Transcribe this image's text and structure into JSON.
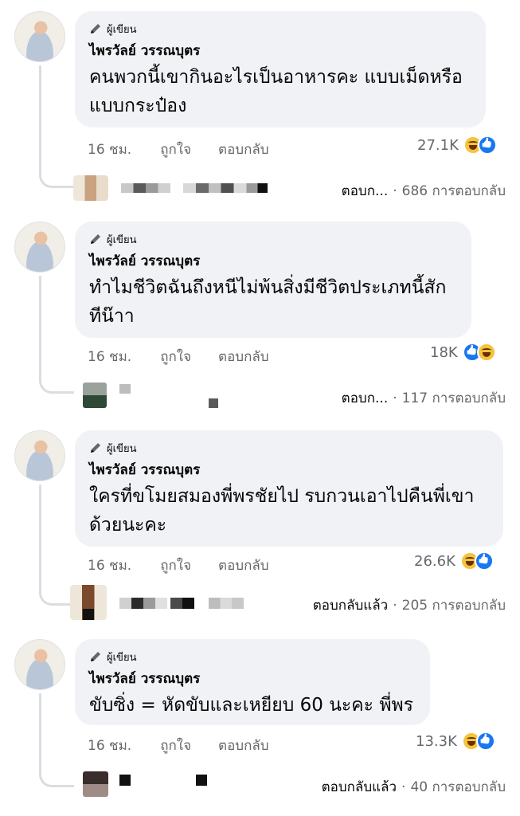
{
  "author_badge": "ผู้เขียน",
  "author_name": "ไพรวัลย์ วรรณบุตร",
  "actions": {
    "like": "ถูกใจ",
    "reply": "ตอบกลับ"
  },
  "comments": [
    {
      "text_line1": "คนพวกนี้เขากินอะไรเป็นอาหารคะ แบบเม็ดหรือ",
      "text_line2": "แบบกระป๋อง",
      "time": "16 ชม.",
      "reaction_count": "27.1K",
      "reactions": [
        "haha-icon",
        "like-icon"
      ],
      "reply_lead": "ตอบก...",
      "reply_count": "686 การตอบกลับ"
    },
    {
      "text_line1": "ทำไมชีวิตฉันถึงหนีไม่พ้นสิ่งมีชีวิตประเภทนี้สัก",
      "text_line2": "ทีน๊าา",
      "time": "16 ชม.",
      "reaction_count": "18K",
      "reactions": [
        "like-icon",
        "haha-icon"
      ],
      "reply_lead": "ตอบก...",
      "reply_count": "117 การตอบกลับ"
    },
    {
      "text_line1": "ใครที่ขโมยสมองพี่พรชัยไป รบกวนเอาไปคืนพี่เขา",
      "text_line2": "ด้วยนะคะ",
      "time": "16 ชม.",
      "reaction_count": "26.6K",
      "reactions": [
        "haha-icon",
        "like-icon"
      ],
      "reply_lead": "ตอบกลับแล้ว",
      "reply_count": "205 การตอบกลับ"
    },
    {
      "text_line1": "ขับซิ่ง = หัดขับและเหยียบ 60 นะคะ พี่พร",
      "text_line2": "",
      "time": "16 ชม.",
      "reaction_count": "13.3K",
      "reactions": [
        "haha-icon",
        "like-icon"
      ],
      "reply_lead": "ตอบกลับแล้ว",
      "reply_count": "40 การตอบกลับ"
    }
  ],
  "colors": {
    "bubble": "#f0f2f5",
    "meta": "#65676b",
    "like_blue": "#1877f2",
    "haha_yellow": "#f7c23c"
  }
}
